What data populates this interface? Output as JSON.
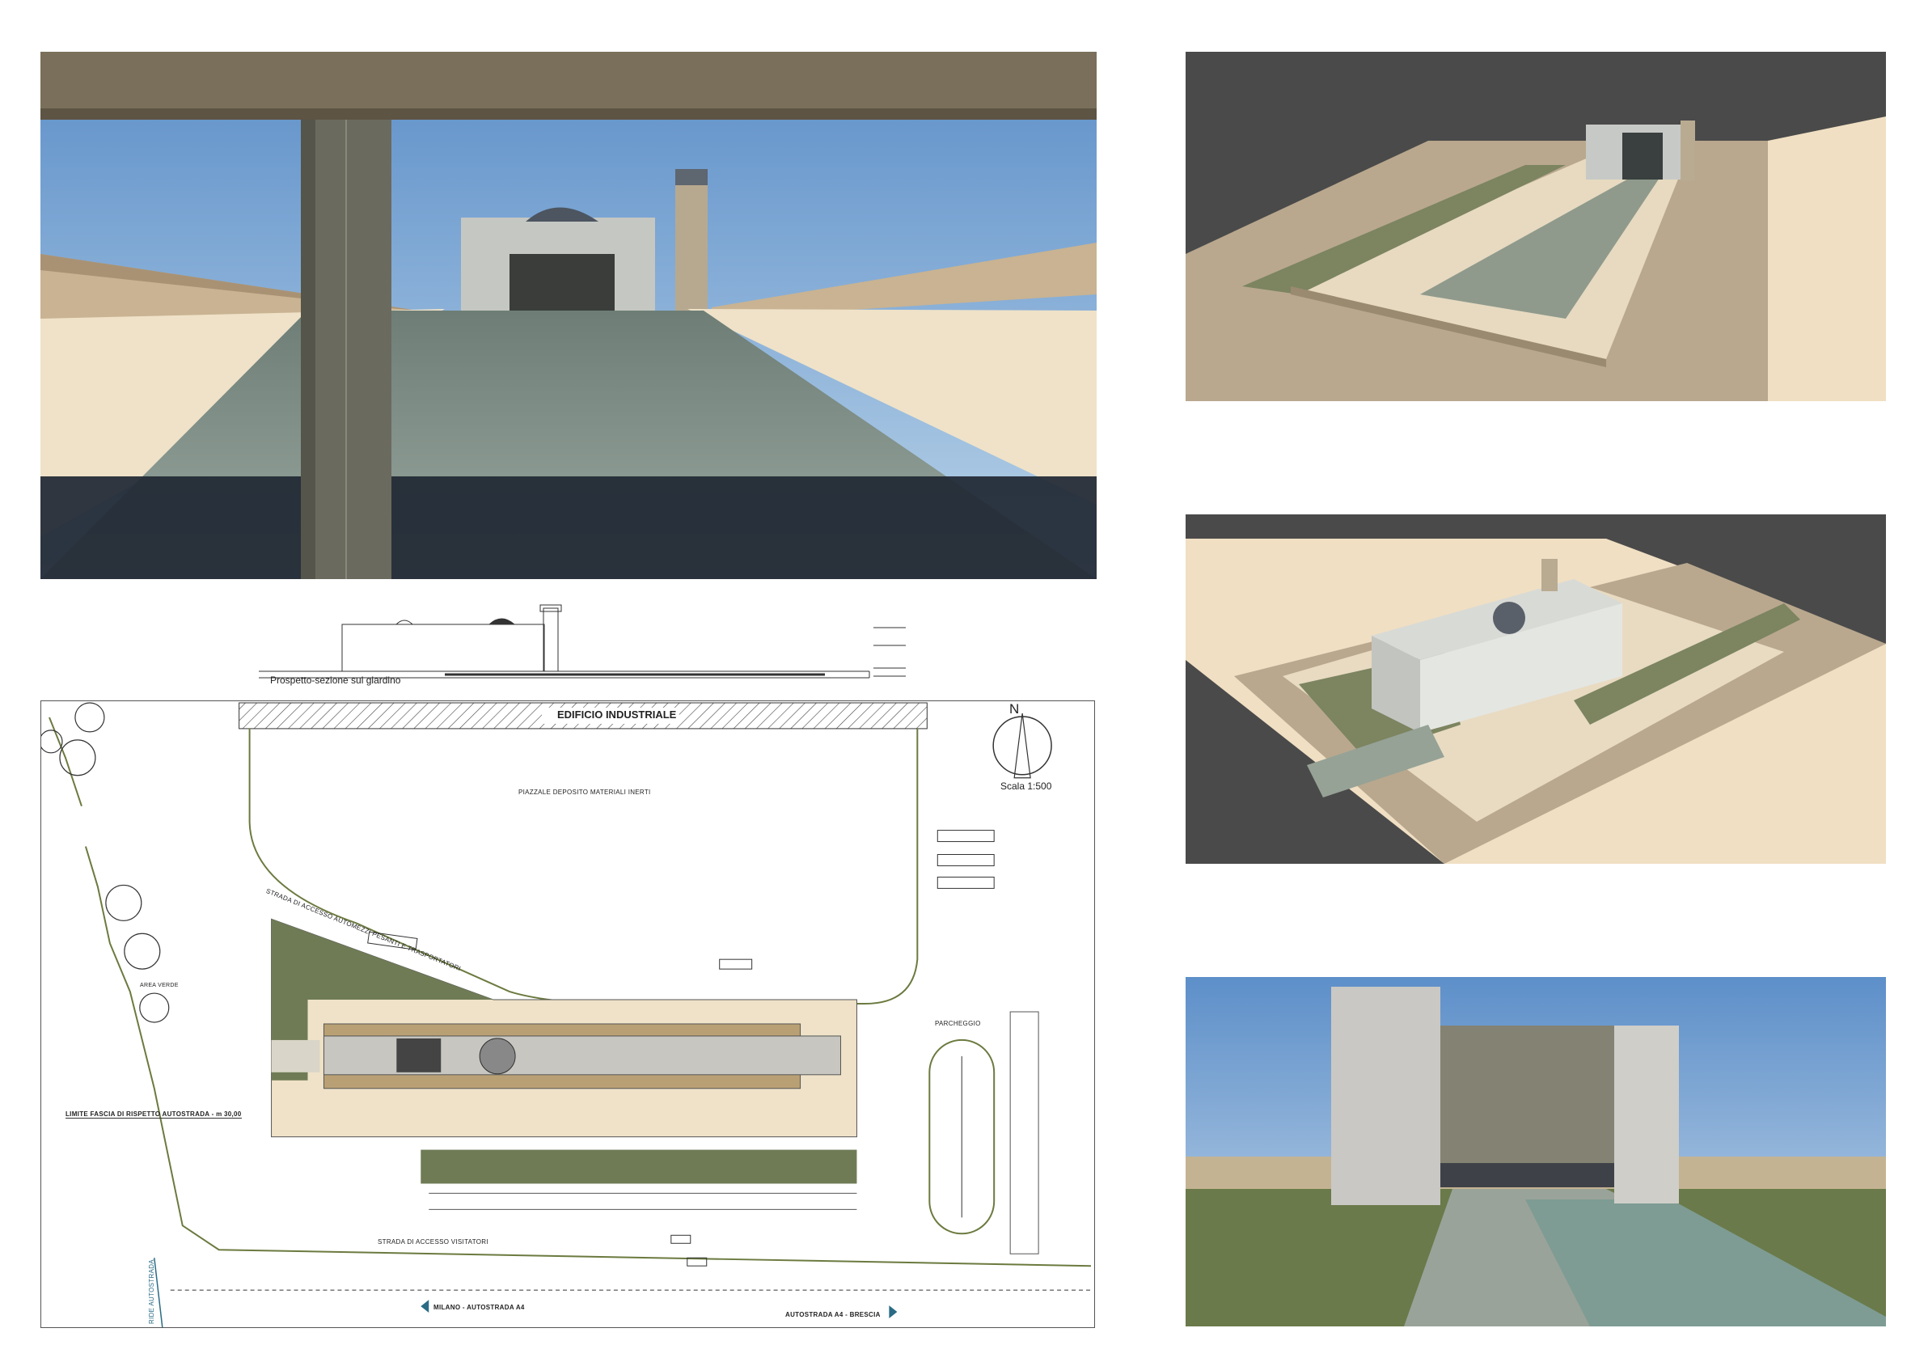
{
  "elevation": {
    "caption": "Prospetto-sezione sul giardino"
  },
  "site_plan": {
    "industrial_building_label": "EDIFICIO INDUSTRIALE",
    "storage_yard_label": "PIAZZALE DEPOSITO MATERIALI INERTI",
    "north_label": "N",
    "scale_label": "Scala 1:500",
    "heavy_access_road_label": "STRADA DI ACCESSO AUTOMEZZI PESANTI E TRASPORTATORI",
    "green_area_label": "AREA VERDE",
    "parking_label": "PARCHEGGIO",
    "highway_buffer_label": "LIMITE FASCIA DI RISPETTO AUTOSTRADA - m 30,00",
    "visitor_access_road_label": "STRADA DI ACCESSO VISITATORI",
    "highway_west_label": "MILANO - AUTOSTRADA A4",
    "highway_east_label": "AUTOSTRADA A4 - BRESCIA",
    "rotated_highway_label": "RIDE AUTOSTRADA"
  },
  "colors": {
    "sky": "#7fa9d6",
    "paving_light": "#efe2c8",
    "stone_gray": "#8c9a8c",
    "grass": "#6f7b55",
    "background_dark": "#4a4a4a",
    "plan_line": "#6b7a3f"
  }
}
